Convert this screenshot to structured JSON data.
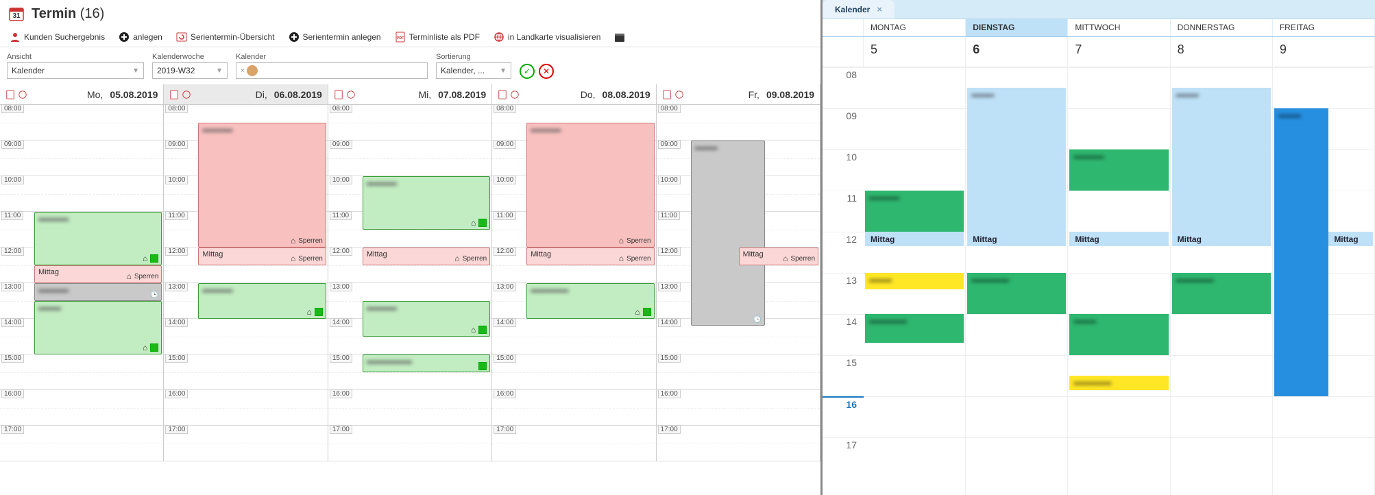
{
  "header": {
    "title_main": "Termin",
    "title_count": "(16)"
  },
  "toolbar": {
    "kunden_suchergebnis": "Kunden Suchergebnis",
    "anlegen": "anlegen",
    "serientermin_uebersicht": "Serientermin-Übersicht",
    "serientermin_anlegen": "Serientermin anlegen",
    "terminliste_pdf": "Terminliste als PDF",
    "in_landkarte": "in Landkarte visualisieren"
  },
  "filters": {
    "ansicht_label": "Ansicht",
    "ansicht_value": "Kalender",
    "kalenderwoche_label": "Kalenderwoche",
    "kalenderwoche_value": "2019-W32",
    "kalender_label": "Kalender",
    "sortierung_label": "Sortierung",
    "sortierung_value": "Kalender, ..."
  },
  "hours": [
    "08:00",
    "09:00",
    "10:00",
    "11:00",
    "12:00",
    "13:00",
    "14:00",
    "15:00",
    "16:00",
    "17:00"
  ],
  "days": [
    {
      "wd": "Mo,",
      "date": "05.08.2019",
      "today": false
    },
    {
      "wd": "Di,",
      "date": "06.08.2019",
      "today": true
    },
    {
      "wd": "Mi,",
      "date": "07.08.2019",
      "today": false
    },
    {
      "wd": "Do,",
      "date": "08.08.2019",
      "today": false
    },
    {
      "wd": "Fr,",
      "date": "09.08.2019",
      "today": false
    }
  ],
  "events": {
    "sperren_label": "Sperren",
    "mittag_label": "Mittag"
  },
  "right": {
    "tab": "Kalender",
    "days": [
      "MONTAG",
      "DIENSTAG",
      "MITTWOCH",
      "DONNERSTAG",
      "FREITAG"
    ],
    "dates": [
      "5",
      "6",
      "7",
      "8",
      "9"
    ],
    "hours": [
      "08",
      "09",
      "10",
      "11",
      "12",
      "13",
      "14",
      "15",
      "16",
      "17"
    ],
    "mittag": "Mittag"
  }
}
